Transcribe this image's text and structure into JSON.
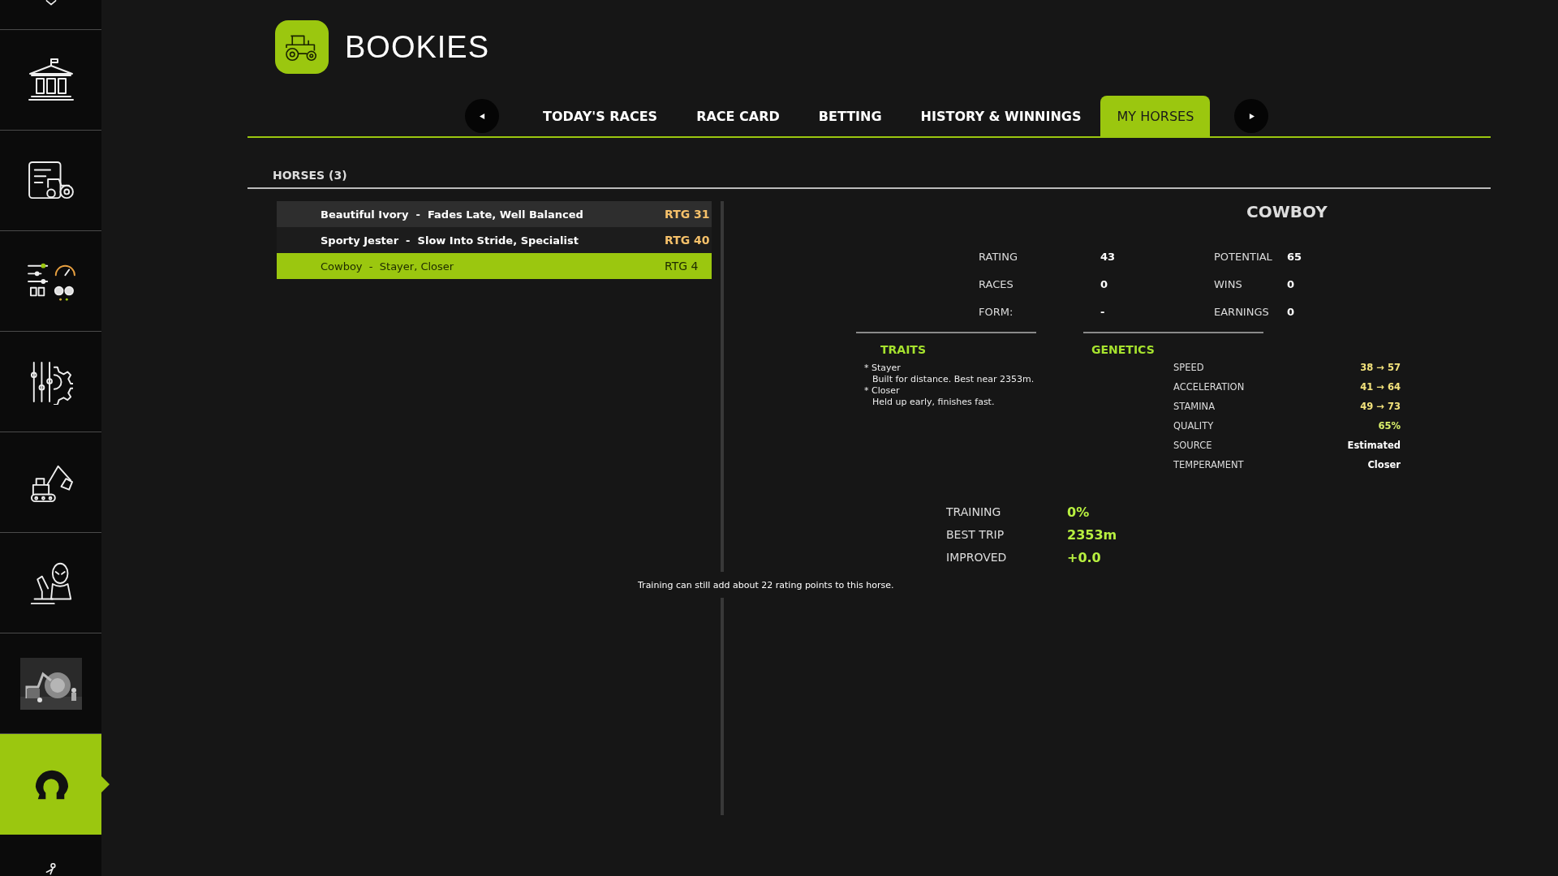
{
  "sidebar": {
    "items": [
      {
        "kind": "icon",
        "selected": false
      },
      {
        "kind": "icon",
        "selected": false
      },
      {
        "kind": "icon",
        "selected": false
      },
      {
        "kind": "icon",
        "selected": false
      },
      {
        "kind": "icon",
        "selected": false
      },
      {
        "kind": "icon",
        "selected": false
      },
      {
        "kind": "icon",
        "selected": false
      },
      {
        "kind": "picture",
        "selected": false
      },
      {
        "kind": "icon",
        "selected": true
      },
      {
        "kind": "icon",
        "selected": false
      }
    ]
  },
  "header": {
    "title": "BOOKIES"
  },
  "tabs": [
    {
      "label": "TODAY'S RACES",
      "selected": false
    },
    {
      "label": "RACE CARD",
      "selected": false
    },
    {
      "label": "BETTING",
      "selected": false
    },
    {
      "label": "HISTORY & WINNINGS",
      "selected": false
    },
    {
      "label": "MY HORSES",
      "selected": true
    }
  ],
  "section_title": "HORSES (3)",
  "horses": [
    {
      "label": "Beautiful Ivory  -  Fades Late, Well Balanced",
      "rating": "RTG 31",
      "selected": false
    },
    {
      "label": "Sporty Jester  -  Slow Into Stride, Specialist",
      "rating": "RTG 40",
      "selected": false
    },
    {
      "label": "Cowboy  -  Stayer, Closer",
      "rating": "RTG 4",
      "selected": true
    }
  ],
  "detail": {
    "name": "COWBOY",
    "stats": [
      {
        "label": "RATING",
        "value": "43"
      },
      {
        "label": "POTENTIAL",
        "value": "65"
      },
      {
        "label": "RACES",
        "value": "0"
      },
      {
        "label": "WINS",
        "value": "0"
      },
      {
        "label": "FORM:",
        "value": "-"
      },
      {
        "label": "EARNINGS",
        "value": "0"
      }
    ],
    "traits_title": "TRAITS",
    "traits": [
      {
        "name": "* Stayer",
        "description": "Built for distance. Best near 2353m."
      },
      {
        "name": "* Closer",
        "description": "Held up early, finishes fast."
      }
    ],
    "genetics_title": "GENETICS",
    "genetics": [
      {
        "label": "SPEED",
        "value": "38 → 57",
        "color": "#f3e27c"
      },
      {
        "label": "ACCELERATION",
        "value": "41 → 64",
        "color": "#f3e27c"
      },
      {
        "label": "STAMINA",
        "value": "49 → 73",
        "color": "#f3e27c"
      },
      {
        "label": "QUALITY",
        "value": "65%",
        "color": "#d9ef6a"
      },
      {
        "label": "SOURCE",
        "value": "Estimated",
        "color": "#ffffff"
      },
      {
        "label": "TEMPERAMENT",
        "value": "Closer",
        "color": "#ffffff"
      }
    ],
    "training": [
      {
        "label": "TRAINING",
        "value": "0%"
      },
      {
        "label": "BEST TRIP",
        "value": "2353m"
      },
      {
        "label": "IMPROVED",
        "value": "+0.0"
      }
    ],
    "note": "Training can still add about 22 rating points to this horse."
  }
}
